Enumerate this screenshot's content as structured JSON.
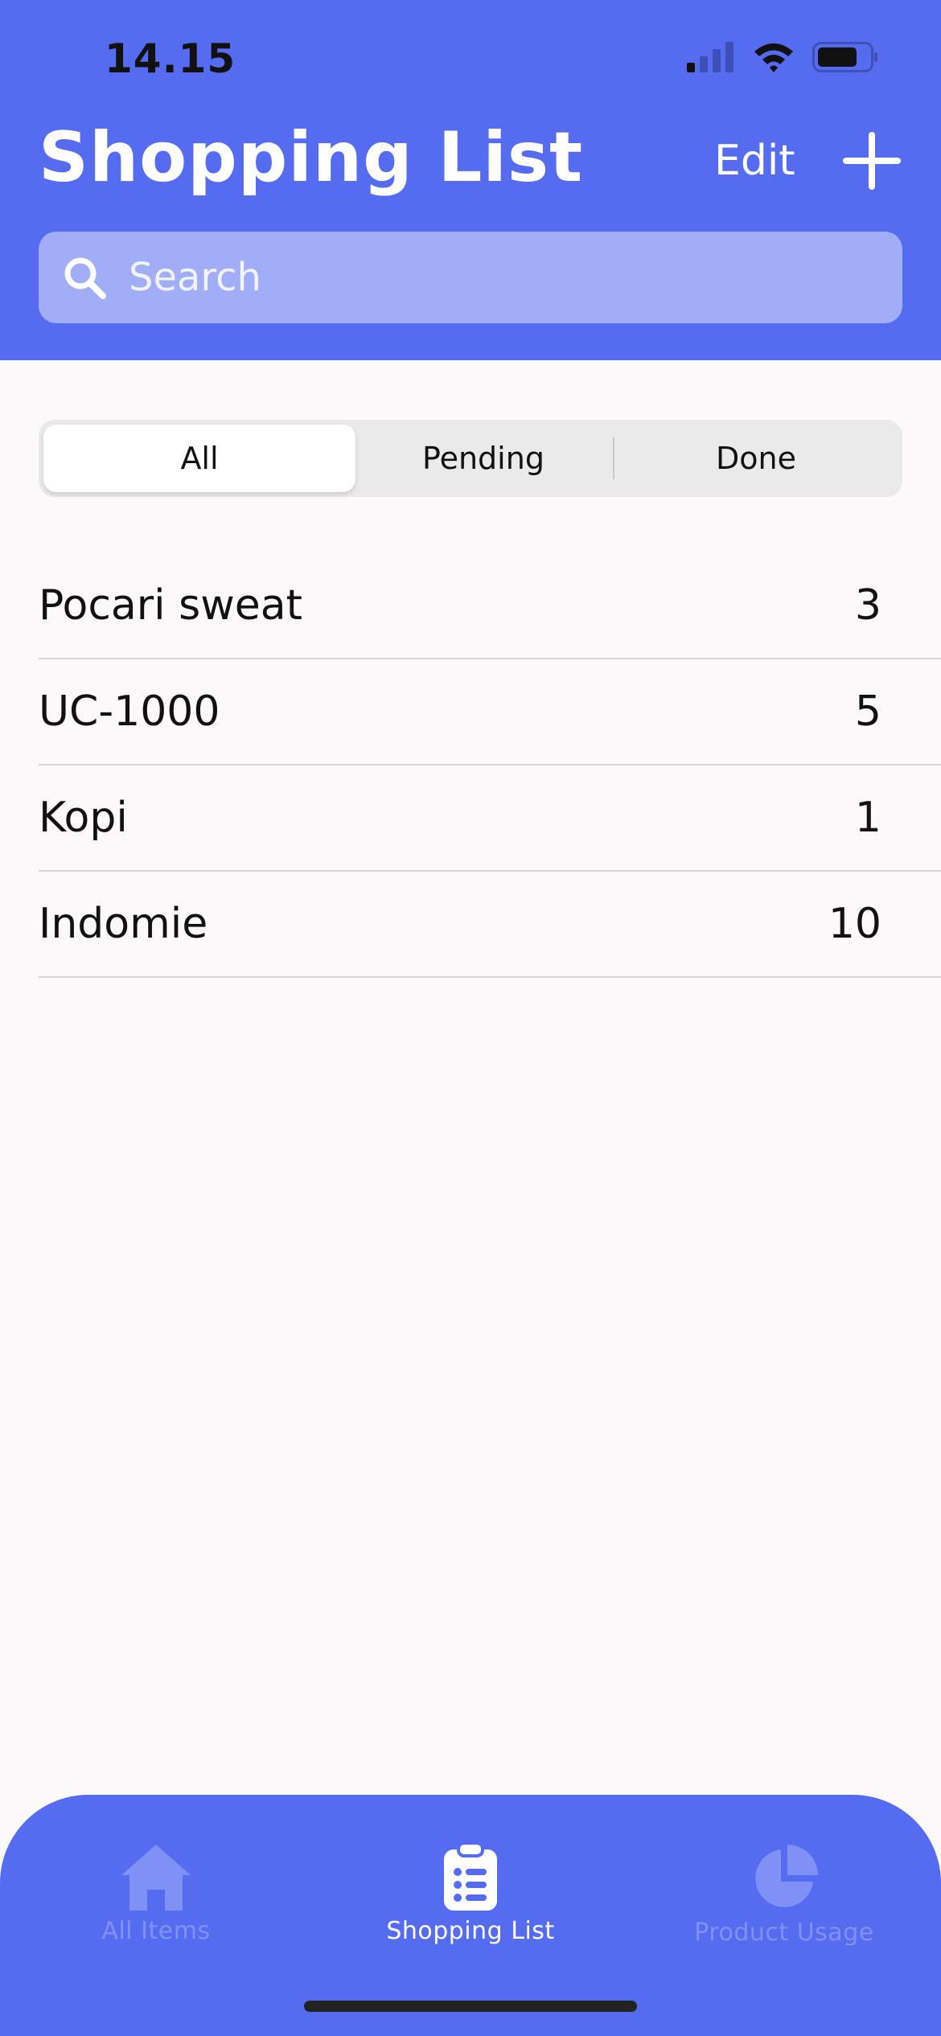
{
  "status_bar": {
    "time": "14.15"
  },
  "header": {
    "title": "Shopping List",
    "edit_label": "Edit",
    "search_placeholder": "Search"
  },
  "filter": {
    "segments": [
      "All",
      "Pending",
      "Done"
    ],
    "selected": "All"
  },
  "items": [
    {
      "name": "Pocari sweat",
      "quantity": "3"
    },
    {
      "name": "UC-1000",
      "quantity": "5"
    },
    {
      "name": "Kopi",
      "quantity": "1"
    },
    {
      "name": "Indomie",
      "quantity": "10"
    }
  ],
  "tabbar": {
    "tabs": [
      {
        "label": "All Items",
        "icon": "home-icon",
        "active": false
      },
      {
        "label": "Shopping List",
        "icon": "clipboard-list-icon",
        "active": true
      },
      {
        "label": "Product Usage",
        "icon": "pie-chart-icon",
        "active": false
      }
    ]
  },
  "colors": {
    "brand": "#556CF0",
    "background": "#FCF9FA",
    "segment_bg": "#EAEAEA"
  }
}
